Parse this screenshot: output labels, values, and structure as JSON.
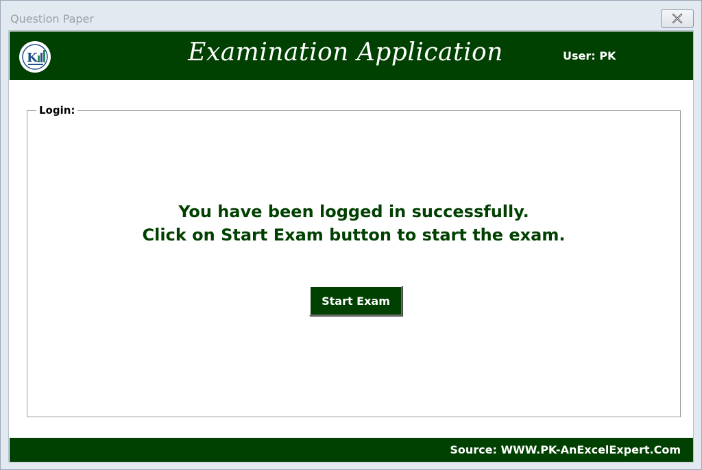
{
  "window": {
    "title": "Question Paper",
    "close_icon": "close-x-icon"
  },
  "header": {
    "app_title": "Examination Application",
    "user_label": "User: PK",
    "logo_icon": "pk-logo-icon"
  },
  "login": {
    "frame_label": "Login:",
    "message_line1": "You have been logged in successfully.",
    "message_line2": "Click on Start Exam button to start the exam.",
    "start_button_label": "Start Exam"
  },
  "footer": {
    "source_text": "Source: WWW.PK-AnExcelExpert.Com"
  },
  "colors": {
    "brand_green": "#004000",
    "window_chrome": "#e3e9f1"
  }
}
